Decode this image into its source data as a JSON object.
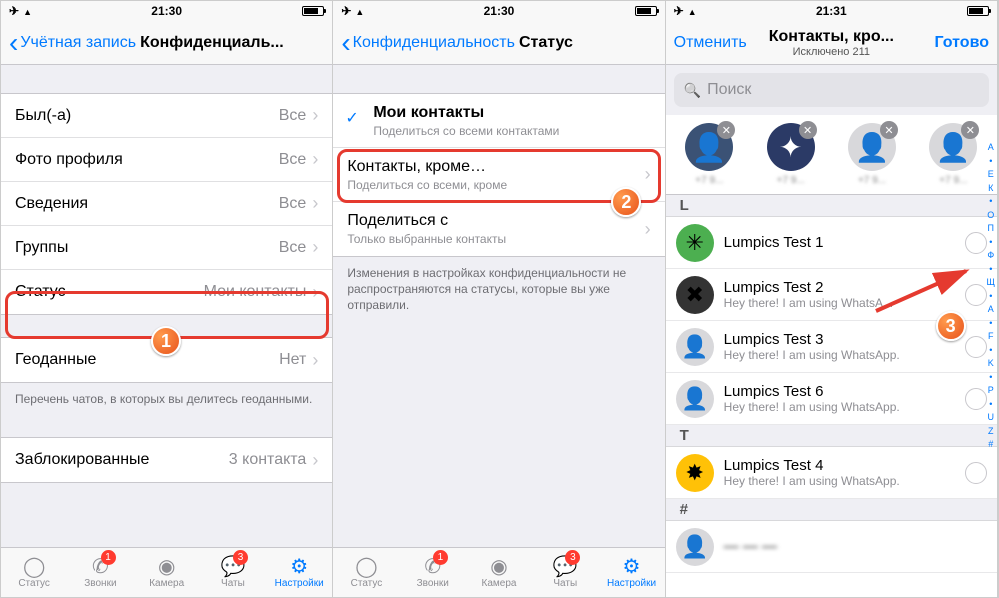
{
  "statusbar": {
    "time1": "21:30",
    "time2": "21:30",
    "time3": "21:31"
  },
  "panel1": {
    "nav_back": "Учётная запись",
    "nav_title": "Конфиденциаль...",
    "rows": {
      "last_seen": {
        "label": "Был(-а)",
        "value": "Все"
      },
      "profile_photo": {
        "label": "Фото профиля",
        "value": "Все"
      },
      "about": {
        "label": "Сведения",
        "value": "Все"
      },
      "groups": {
        "label": "Группы",
        "value": "Все"
      },
      "status": {
        "label": "Статус",
        "value": "Мои контакты"
      },
      "location": {
        "label": "Геоданные",
        "value": "Нет"
      },
      "blocked": {
        "label": "Заблокированные",
        "value": "3 контакта"
      }
    },
    "location_note": "Перечень чатов, в которых вы делитесь геоданными."
  },
  "panel2": {
    "nav_back": "Конфиденциальность",
    "nav_title": "Статус",
    "opts": {
      "my_contacts": {
        "label": "Мои контакты",
        "sub": "Поделиться со всеми контактами"
      },
      "except": {
        "label": "Контакты, кроме…",
        "sub": "Поделиться со всеми, кроме"
      },
      "only": {
        "label": "Поделиться с",
        "sub": "Только выбранные контакты"
      }
    },
    "note": "Изменения в настройках конфиденциальности не распространяются на статусы, которые вы уже отправили."
  },
  "panel3": {
    "nav_cancel": "Отменить",
    "nav_title": "Контакты, кро...",
    "nav_sub": "Исключено 211",
    "nav_done": "Готово",
    "search_placeholder": "Поиск",
    "section_L": "L",
    "section_T": "T",
    "section_hash": "#",
    "contacts": {
      "l1": {
        "name": "Lumpics Test 1",
        "sub": ""
      },
      "l2": {
        "name": "Lumpics Test 2",
        "sub": "Hey there! I am using WhatsA..."
      },
      "l3": {
        "name": "Lumpics Test 3",
        "sub": "Hey there! I am using WhatsApp."
      },
      "l6": {
        "name": "Lumpics Test 6",
        "sub": "Hey there! I am using WhatsApp."
      },
      "l4": {
        "name": "Lumpics Test 4",
        "sub": "Hey there! I am using WhatsApp."
      }
    },
    "index": [
      "А",
      "•",
      "Е",
      "К",
      "•",
      "О",
      "П",
      "•",
      "Ф",
      "•",
      "Щ",
      "•",
      "A",
      "•",
      "F",
      "•",
      "K",
      "•",
      "P",
      "•",
      "U",
      "Z",
      "#"
    ]
  },
  "tabs": {
    "status": "Статус",
    "calls": "Звонки",
    "camera": "Камера",
    "chats": "Чаты",
    "settings": "Настройки",
    "calls_badge": "1",
    "chats_badge": "3"
  },
  "annotations": {
    "b1": "1",
    "b2": "2",
    "b3": "3"
  }
}
